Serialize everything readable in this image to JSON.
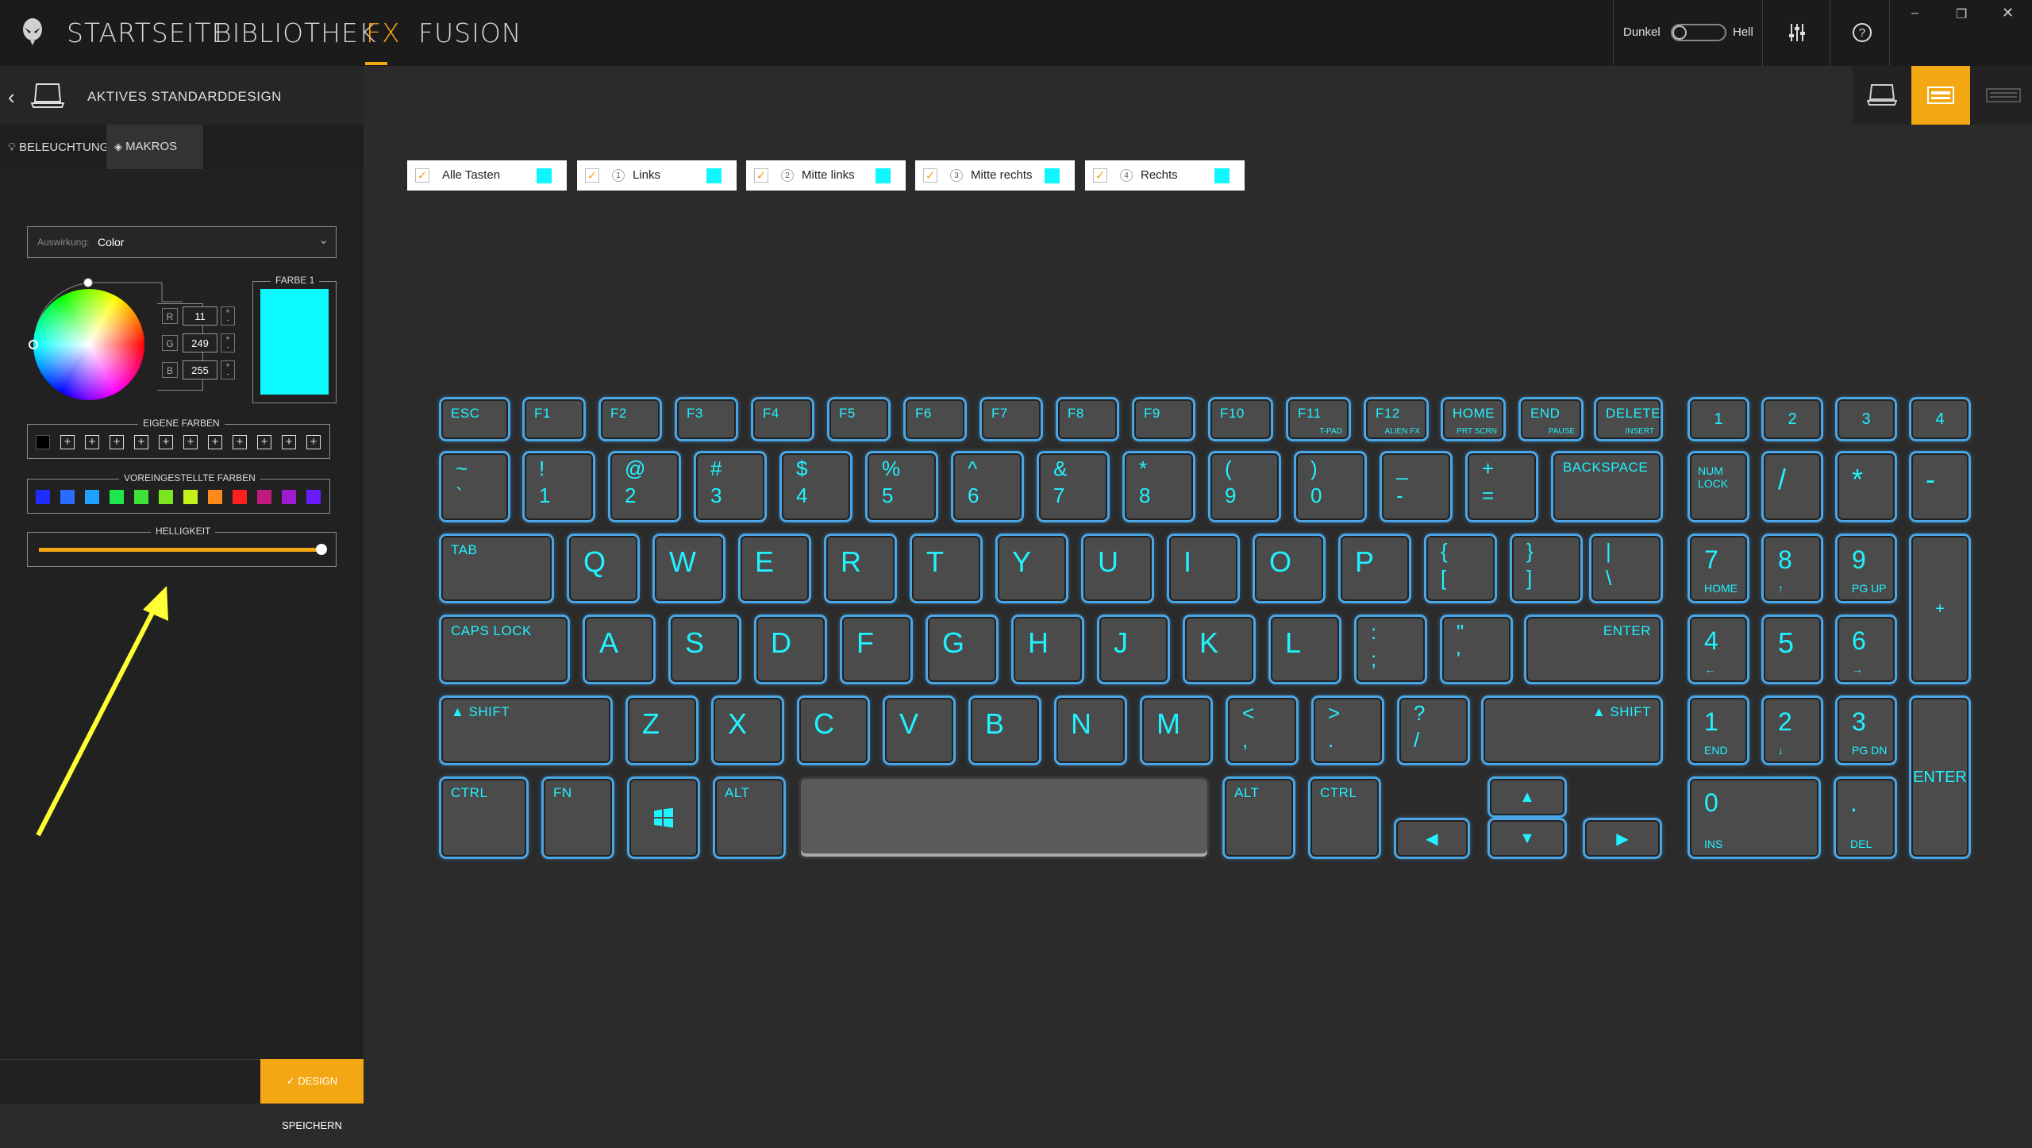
{
  "nav": {
    "home": "STARTSEITE",
    "library": "BIBLIOTHEK",
    "fx": "FX",
    "fusion": "FUSION"
  },
  "theme": {
    "dark": "Dunkel",
    "light": "Hell"
  },
  "window": {
    "minimize": "–",
    "restore": "❐",
    "close": "✕"
  },
  "design": {
    "title": "AKTIVES STANDARDDESIGN"
  },
  "tabs": {
    "lighting": "BELEUCHTUNG",
    "macros": "MAKROS"
  },
  "effect": {
    "label": "Auswirkung:",
    "value": "Color"
  },
  "color": {
    "r_label": "R",
    "g_label": "G",
    "b_label": "B",
    "r": "11",
    "g": "249",
    "b": "255",
    "swatch_label": "FARBE 1",
    "swatch_color": "#0bf9ff"
  },
  "custom_colors": {
    "label": "EIGENE FARBEN",
    "first": "#000000",
    "plus_count": 11
  },
  "preset_colors": {
    "label": "VOREINGESTELLTE FARBEN",
    "colors": [
      "#1f2cff",
      "#2a6cff",
      "#1fa0ff",
      "#1fe64a",
      "#40e03a",
      "#7be620",
      "#c6f01a",
      "#ff8a1a",
      "#ff2020",
      "#c01a80",
      "#a01ad0",
      "#6a1aff"
    ]
  },
  "brightness": {
    "label": "HELLIGKEIT",
    "value": 1.0
  },
  "save": {
    "label": "✓ DESIGN SPEICHERN"
  },
  "zones": [
    {
      "label": "Alle Tasten",
      "num": ""
    },
    {
      "label": "Links",
      "num": "1"
    },
    {
      "label": "Mitte links",
      "num": "2"
    },
    {
      "label": "Mitte rechts",
      "num": "3"
    },
    {
      "label": "Rechts",
      "num": "4"
    }
  ],
  "keys": {
    "esc": "ESC",
    "f1": "F1",
    "f2": "F2",
    "f3": "F3",
    "f4": "F4",
    "f5": "F5",
    "f6": "F6",
    "f7": "F7",
    "f8": "F8",
    "f9": "F9",
    "f10": "F10",
    "f11": "F11",
    "f11_sub": "T-PAD",
    "f12": "F12",
    "f12_sub": "ALIEN FX",
    "home": "HOME",
    "home_sub": "PRT SCRN",
    "end": "END",
    "end_sub": "PAUSE",
    "delete": "DELETE",
    "delete_sub": "INSERT",
    "m1": "1",
    "m2": "2",
    "m3": "3",
    "m4": "4",
    "tilde_up": "~",
    "tilde_dn": "`",
    "n1_up": "!",
    "n1_dn": "1",
    "n2_up": "@",
    "n2_dn": "2",
    "n3_up": "#",
    "n3_dn": "3",
    "n4_up": "$",
    "n4_dn": "4",
    "n5_up": "%",
    "n5_dn": "5",
    "n6_up": "^",
    "n6_dn": "6",
    "n7_up": "&",
    "n7_dn": "7",
    "n8_up": "*",
    "n8_dn": "8",
    "n9_up": "(",
    "n9_dn": "9",
    "n0_up": ")",
    "n0_dn": "0",
    "minus_up": "_",
    "minus_dn": "-",
    "eq_up": "+",
    "eq_dn": "=",
    "backspace": "BACKSPACE",
    "numlock": "NUM LOCK",
    "np_div": "/",
    "np_mul": "*",
    "np_min": "-",
    "tab": "TAB",
    "q": "Q",
    "w": "W",
    "e": "E",
    "r": "R",
    "t": "T",
    "y": "Y",
    "u": "U",
    "i": "I",
    "o": "O",
    "p": "P",
    "lb_up": "{",
    "lb_dn": "[",
    "rb_up": "}",
    "rb_dn": "]",
    "bs_up": "|",
    "bs_dn": "\\",
    "np7": "7",
    "np7_sub": "HOME",
    "np8": "8",
    "np8_sub": "↑",
    "np9": "9",
    "np9_sub": "PG UP",
    "np_plus": "+",
    "caps": "CAPS LOCK",
    "a": "A",
    "s": "S",
    "d": "D",
    "f": "F",
    "g": "G",
    "h": "H",
    "j": "J",
    "k": "K",
    "l": "L",
    "semi_up": ":",
    "semi_dn": ";",
    "quote_up": "\"",
    "quote_dn": "'",
    "enter": "ENTER",
    "np4": "4",
    "np4_sub": "←",
    "np5": "5",
    "np6": "6",
    "np6_sub": "→",
    "lshift": "▲ SHIFT",
    "z": "Z",
    "x": "X",
    "c": "C",
    "v": "V",
    "b": "B",
    "n": "N",
    "m": "M",
    "comma_up": "<",
    "comma_dn": ",",
    "dot_up": ">",
    "dot_dn": ".",
    "slash_up": "?",
    "slash_dn": "/",
    "rshift": "▲ SHIFT",
    "np1": "1",
    "np1_sub": "END",
    "np2": "2",
    "np2_sub": "↓",
    "np3": "3",
    "np3_sub": "PG DN",
    "np_enter": "ENTER",
    "lctrl": "CTRL",
    "fn": "FN",
    "lalt": "ALT",
    "ralt": "ALT",
    "rctrl": "CTRL",
    "left": "◀",
    "up": "▲",
    "down": "▼",
    "right": "▶",
    "np0": "0",
    "np0_sub": "INS",
    "np_dot": ".",
    "np_dot_sub": "DEL"
  }
}
